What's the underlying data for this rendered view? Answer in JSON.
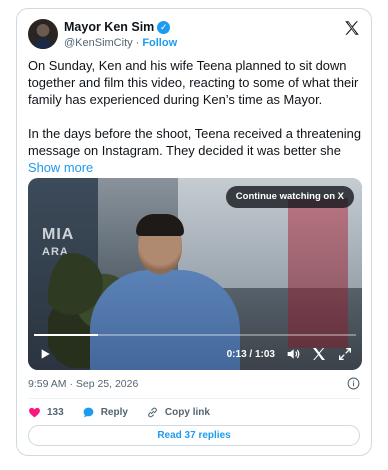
{
  "author": {
    "display_name": "Mayor Ken Sim",
    "handle": "@KenSimCity",
    "separator": "·",
    "follow_label": "Follow",
    "verified_glyph": "✓"
  },
  "tweet": {
    "paragraph1": "On Sunday, Ken and his wife Teena planned to sit down together and film this video, reacting to some of what their family has experienced during Ken’s time as Mayor.",
    "paragraph2_start": "In the days before the shoot, Teena received a threatening message on Instagram. They decided it was better she ",
    "show_more": "Show more"
  },
  "video": {
    "continue_label": "Continue watching on X",
    "time_readout": "0:13 / 1:03",
    "progress": 0.2,
    "sign_text_1": "MIA",
    "sign_text_2": "ARA"
  },
  "meta": {
    "timestamp": "9:59 AM · Sep 25, 2026"
  },
  "actions": {
    "like_count": "133",
    "reply_label": "Reply",
    "copy_link_label": "Copy link"
  },
  "footer": {
    "read_replies_label": "Read 37 replies"
  },
  "colors": {
    "accent": "#1d9bf0",
    "like": "#f91880",
    "muted": "#536471"
  },
  "icons": [
    "verified-badge-icon",
    "x-logo-icon",
    "play-icon",
    "volume-icon",
    "x-small-icon",
    "expand-icon",
    "info-icon",
    "heart-icon",
    "reply-icon",
    "link-icon"
  ]
}
